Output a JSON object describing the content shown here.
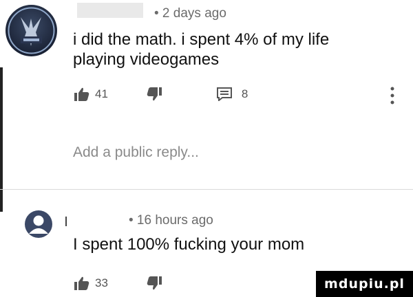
{
  "comment1": {
    "time": "• 2 days ago",
    "text_line1": "i did the math. i spent 4% of my life",
    "text_line2": "playing videogames",
    "likes": "41",
    "replies": "8",
    "avatar_icon": "blue-crest-avatar",
    "like_icon": "thumbs-up-icon",
    "dislike_icon": "thumbs-down-icon",
    "reply_icon": "comment-icon",
    "more_icon": "more-vertical-icon"
  },
  "reply_box": {
    "placeholder": "Add a public reply..."
  },
  "comment2": {
    "time": "• 16 hours ago",
    "text": "I spent 100% fucking your mom",
    "likes": "33",
    "avatar_icon": "default-user-avatar",
    "like_icon": "thumbs-up-icon",
    "dislike_icon": "thumbs-down-icon"
  },
  "watermark": "mdupiu.pl"
}
